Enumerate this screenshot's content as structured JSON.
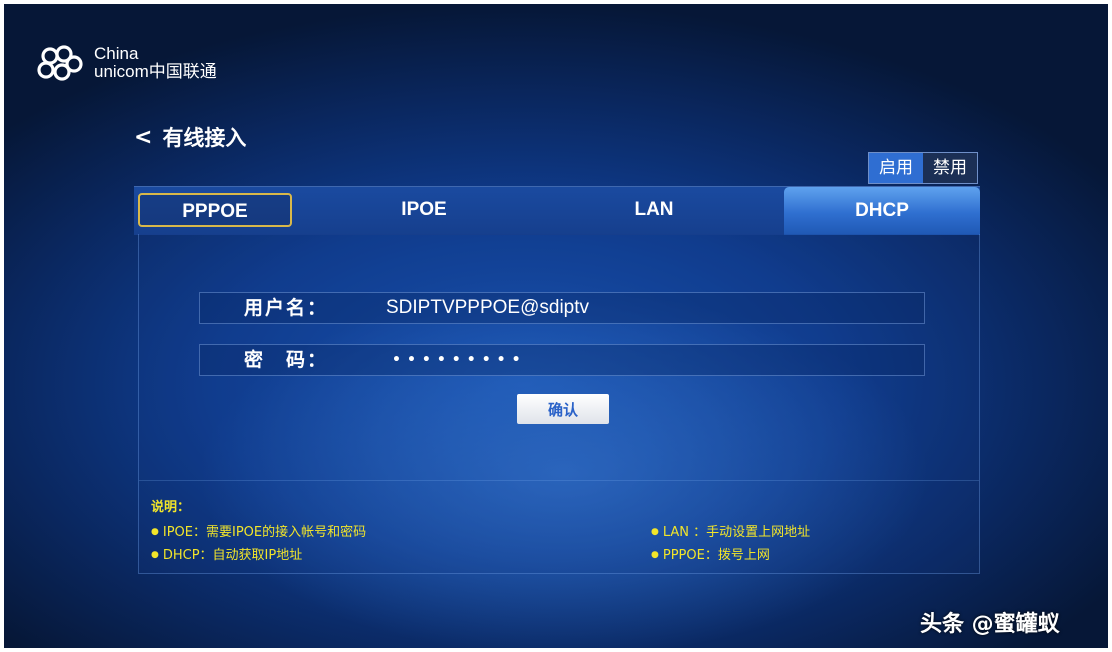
{
  "brand": {
    "en": "China",
    "cn_line": "unicom中国联通"
  },
  "header": {
    "back_title": "有线接入",
    "back_chevron": "<"
  },
  "toggle": {
    "options": [
      "启用",
      "禁用"
    ],
    "selected": "启用"
  },
  "tabs": [
    "PPPOE",
    "IPOE",
    "LAN",
    "DHCP"
  ],
  "focused_tab": "PPPOE",
  "active_tab": "DHCP",
  "form": {
    "username_label": "用户名：",
    "username_value": "SDIPTVPPPOE@sdiptv",
    "password_label": "密　码：",
    "password_masked": "•••••••••",
    "confirm_label": "确认"
  },
  "notes": {
    "title": "说明：",
    "bullet": "●",
    "items": [
      "IPOE：需要IPOE的接入帐号和密码",
      "LAN ：手动设置上网地址",
      "DHCP：自动获取IP地址",
      "PPPOE：拨号上网"
    ]
  },
  "watermark": "头条 @蜜罐蚁",
  "colors": {
    "accent": "#2f6ed2",
    "note_text": "#f2e52a",
    "focus_border": "#d8b84a"
  }
}
